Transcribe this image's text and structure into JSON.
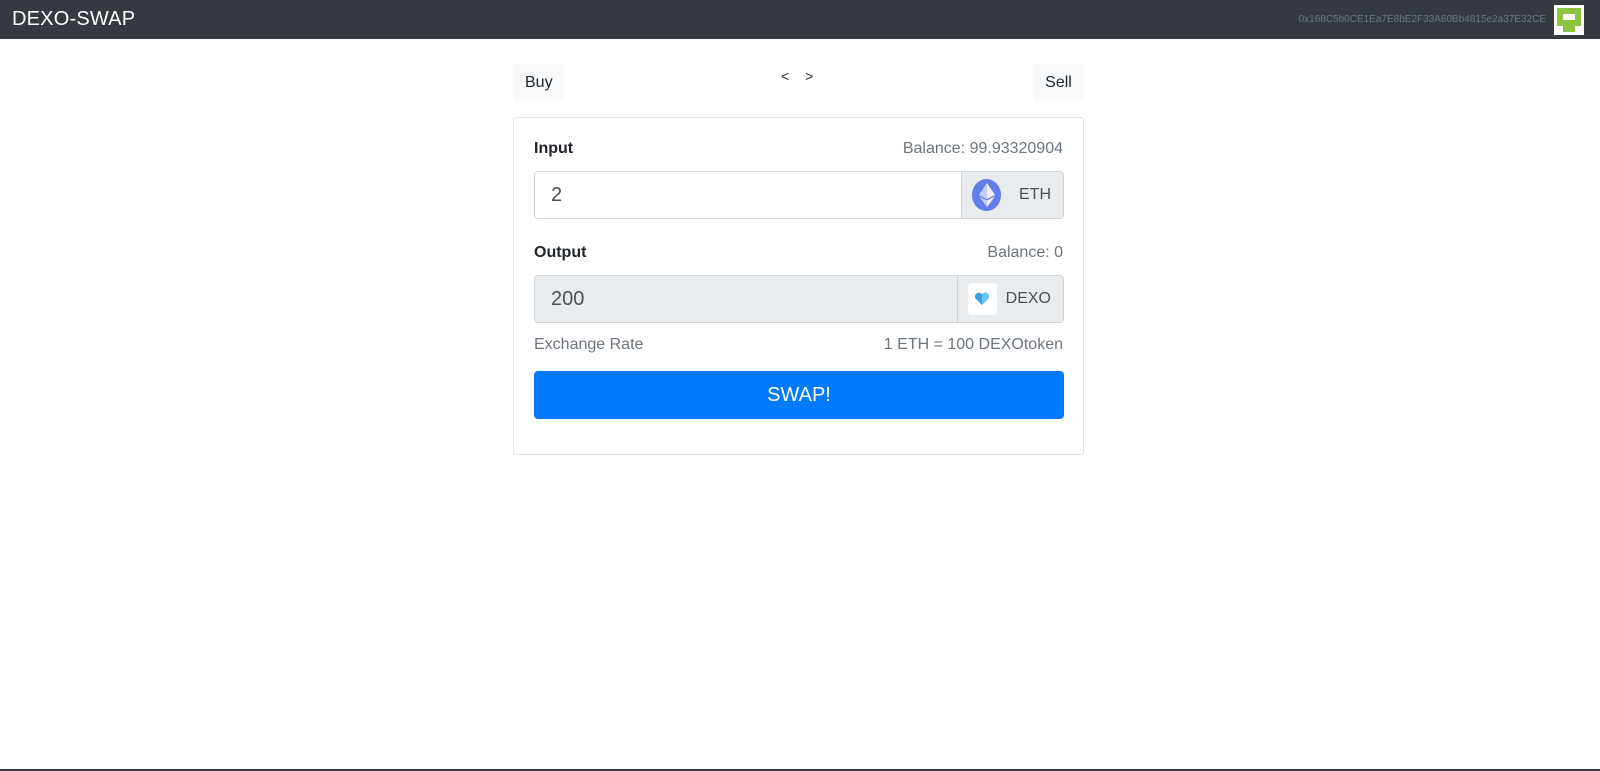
{
  "navbar": {
    "brand": "DEXO-SWAP",
    "account_address": "0x168C5b0CE1Ea7E8bE2F33A60Bb4815e2a37E32CE",
    "avatar_icon": "identicon-avatar"
  },
  "tabs": {
    "buy_label": "Buy",
    "sell_label": "Sell",
    "prev_label": "<",
    "next_label": ">"
  },
  "input": {
    "label": "Input",
    "balance": "Balance: 99.93320904",
    "value": "2",
    "token": "ETH",
    "token_icon": "ethereum-icon"
  },
  "output": {
    "label": "Output",
    "balance": "Balance: 0",
    "value": "200",
    "token": "DEXO",
    "token_icon": "dexo-token-icon"
  },
  "rate": {
    "label": "Exchange Rate",
    "value": "1 ETH = 100 DEXOtoken"
  },
  "swap_label": "SWAP!",
  "colors": {
    "navbar": "#343a40",
    "primary": "#007bff",
    "eth": "#627eea",
    "avatar_green": "#8cc63f"
  }
}
